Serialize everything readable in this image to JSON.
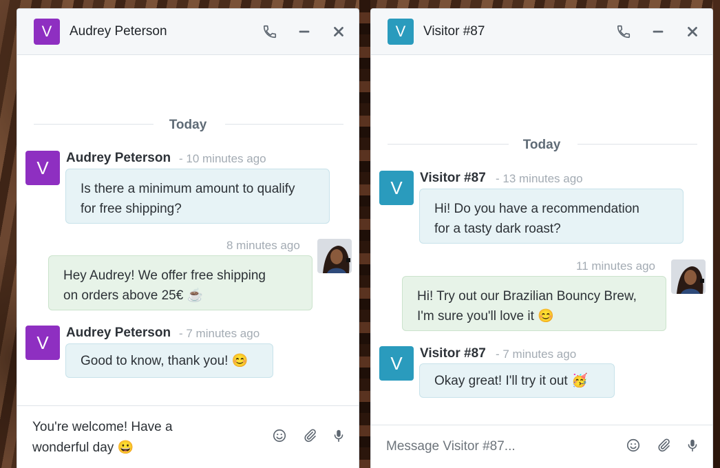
{
  "colors": {
    "avatar_purple": "#8e2fc1",
    "avatar_teal": "#2a9bbd",
    "incoming_bubble": "#e7f3f6",
    "outgoing_bubble": "#e7f3e8"
  },
  "chat1": {
    "header": {
      "avatar_letter": "V",
      "name": "Audrey Peterson"
    },
    "divider": "Today",
    "messages": [
      {
        "author": "Audrey Peterson",
        "time": "- 10 minutes ago",
        "avatar_letter": "V",
        "lines": [
          "Is there a minimum amount to qualify",
          "for free shipping?"
        ]
      },
      {
        "time": "8 minutes ago",
        "lines": [
          "Hey Audrey! We offer free shipping",
          "on orders above 25€ ☕"
        ]
      },
      {
        "author": "Audrey Peterson",
        "time": "- 7 minutes ago",
        "avatar_letter": "V",
        "lines": [
          "Good to know, thank you! 😊"
        ]
      }
    ],
    "composer": {
      "lines": [
        "You're welcome! Have a",
        "wonderful day 😀"
      ]
    }
  },
  "chat2": {
    "header": {
      "avatar_letter": "V",
      "name": "Visitor #87"
    },
    "divider": "Today",
    "messages": [
      {
        "author": "Visitor #87",
        "time": "- 13 minutes ago",
        "avatar_letter": "V",
        "lines": [
          "Hi! Do you have a recommendation",
          "for a tasty dark roast?"
        ]
      },
      {
        "time": "11 minutes ago",
        "lines": [
          "Hi! Try out our Brazilian Bouncy Brew,",
          "I'm sure you'll love it 😊"
        ]
      },
      {
        "author": "Visitor #87",
        "time": "- 7 minutes ago",
        "avatar_letter": "V",
        "lines": [
          "Okay great! I'll try it out 🥳"
        ]
      }
    ],
    "composer": {
      "placeholder": "Message Visitor #87..."
    }
  },
  "icons": {
    "header": [
      "phone-icon",
      "minimize-icon",
      "close-icon"
    ],
    "composer": [
      "emoji-icon",
      "paperclip-icon",
      "microphone-icon"
    ]
  }
}
